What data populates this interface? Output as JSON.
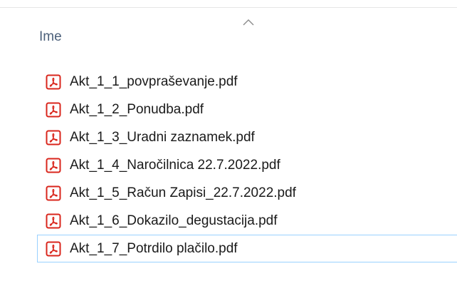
{
  "header": {
    "column_name": "Ime",
    "sort_icon": "chevron-up-icon"
  },
  "files": [
    {
      "name": "Akt_1_1_povpraševanje.pdf",
      "icon": "pdf-icon"
    },
    {
      "name": "Akt_1_2_Ponudba.pdf",
      "icon": "pdf-icon"
    },
    {
      "name": "Akt_1_3_Uradni zaznamek.pdf",
      "icon": "pdf-icon"
    },
    {
      "name": "Akt_1_4_Naročilnica 22.7.2022.pdf",
      "icon": "pdf-icon"
    },
    {
      "name": "Akt_1_5_Račun Zapisi_22.7.2022.pdf",
      "icon": "pdf-icon"
    },
    {
      "name": "Akt_1_6_Dokazilo_degustacija.pdf",
      "icon": "pdf-icon"
    },
    {
      "name": "Akt_1_7_Potrdilo plačilo.pdf",
      "icon": "pdf-icon",
      "selected": true
    }
  ],
  "colors": {
    "pdf_red": "#d9261c",
    "header_text": "#4c607a",
    "selection_border": "#99d1ff"
  }
}
